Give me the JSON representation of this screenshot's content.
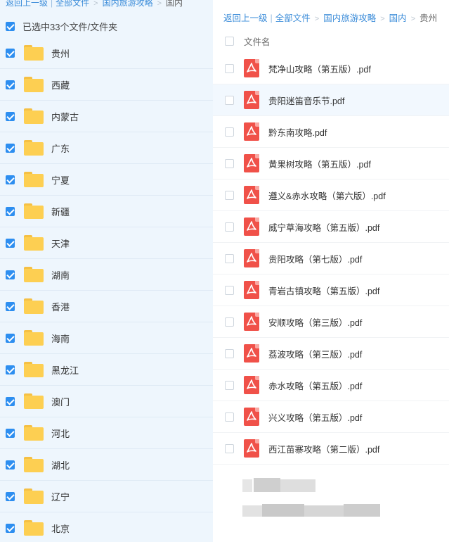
{
  "left_breadcrumb": {
    "back": "返回上一级",
    "all": "全部文件",
    "domestic": "国内旅游攻略",
    "current": "国内"
  },
  "selection": {
    "text": "已选中33个文件/文件夹"
  },
  "folders": [
    {
      "name": "贵州"
    },
    {
      "name": "西藏"
    },
    {
      "name": "内蒙古"
    },
    {
      "name": "广东"
    },
    {
      "name": "宁夏"
    },
    {
      "name": "新疆"
    },
    {
      "name": "天津"
    },
    {
      "name": "湖南"
    },
    {
      "name": "香港"
    },
    {
      "name": "海南"
    },
    {
      "name": "黑龙江"
    },
    {
      "name": "澳门"
    },
    {
      "name": "河北"
    },
    {
      "name": "湖北"
    },
    {
      "name": "辽宁"
    },
    {
      "name": "北京"
    }
  ],
  "right_breadcrumb": {
    "back": "返回上一级",
    "all": "全部文件",
    "domestic": "国内旅游攻略",
    "country": "国内",
    "current": "贵州"
  },
  "files_header": {
    "name": "文件名"
  },
  "files": [
    {
      "name": "梵净山攻略（第五版）.pdf"
    },
    {
      "name": "贵阳迷笛音乐节.pdf"
    },
    {
      "name": "黔东南攻略.pdf"
    },
    {
      "name": "黄果树攻略（第五版）.pdf"
    },
    {
      "name": "遵义&赤水攻略（第六版）.pdf"
    },
    {
      "name": "威宁草海攻略（第五版）.pdf"
    },
    {
      "name": "贵阳攻略（第七版）.pdf"
    },
    {
      "name": "青岩古镇攻略（第五版）.pdf"
    },
    {
      "name": "安顺攻略（第三版）.pdf"
    },
    {
      "name": "荔波攻略（第三版）.pdf"
    },
    {
      "name": "赤水攻略（第五版）.pdf"
    },
    {
      "name": "兴义攻略（第五版）.pdf"
    },
    {
      "name": "西江苗寨攻略（第二版）.pdf"
    }
  ],
  "colors": {
    "accent": "#2d8ef0",
    "link": "#3b8cd9",
    "folder": "#fdcf52",
    "pdf": "#f05149",
    "selected_bg": "#eef6fd"
  }
}
